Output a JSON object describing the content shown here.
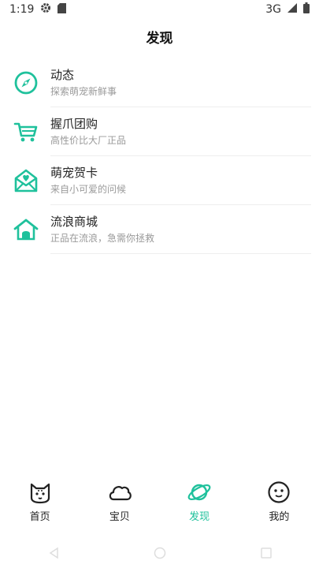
{
  "status": {
    "time": "1:19",
    "network": "3G"
  },
  "title": "发现",
  "menu": [
    {
      "icon": "compass-icon",
      "title": "动态",
      "subtitle": "探索萌宠新鲜事"
    },
    {
      "icon": "shopping-cart-icon",
      "title": "握爪团购",
      "subtitle": "高性价比大厂正品"
    },
    {
      "icon": "envelope-heart-icon",
      "title": "萌宠贺卡",
      "subtitle": "来自小可爱的问候"
    },
    {
      "icon": "house-icon",
      "title": "流浪商城",
      "subtitle": "正品在流浪，急需你拯救"
    }
  ],
  "nav": [
    {
      "icon": "cat-face-icon",
      "label": "首页",
      "active": false
    },
    {
      "icon": "cloud-icon",
      "label": "宝贝",
      "active": false
    },
    {
      "icon": "planet-icon",
      "label": "发现",
      "active": true
    },
    {
      "icon": "smiley-icon",
      "label": "我的",
      "active": false
    }
  ],
  "colors": {
    "accent": "#1fc19c",
    "text": "#222222",
    "subtext": "#9a9a9a"
  }
}
